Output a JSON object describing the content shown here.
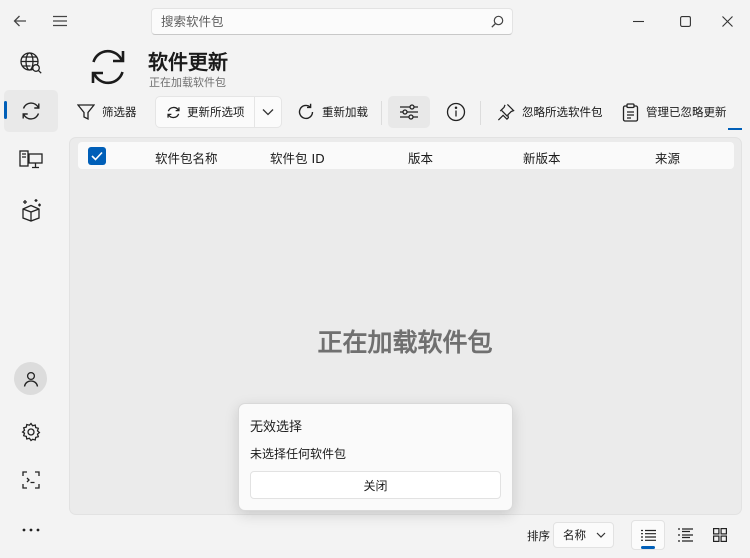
{
  "search": {
    "placeholder": "搜索软件包"
  },
  "header": {
    "title": "软件更新",
    "subtitle": "正在加载软件包"
  },
  "toolbar": {
    "filters": "筛选器",
    "update_selected": "更新所选项",
    "reload": "重新加载",
    "ignore_selected": "忽略所选软件包",
    "manage_ignored": "管理已忽略更新"
  },
  "table": {
    "columns": [
      "软件包名称",
      "软件包 ID",
      "版本",
      "新版本",
      "来源"
    ]
  },
  "main": {
    "loading": "正在加载软件包"
  },
  "dialog": {
    "title": "无效选择",
    "message": "未选择任何软件包",
    "close": "关闭"
  },
  "bottom": {
    "sort_label": "排序",
    "sort_value": "名称"
  },
  "colors": {
    "accent": "#005fb8",
    "background": "#f3f3f3"
  }
}
